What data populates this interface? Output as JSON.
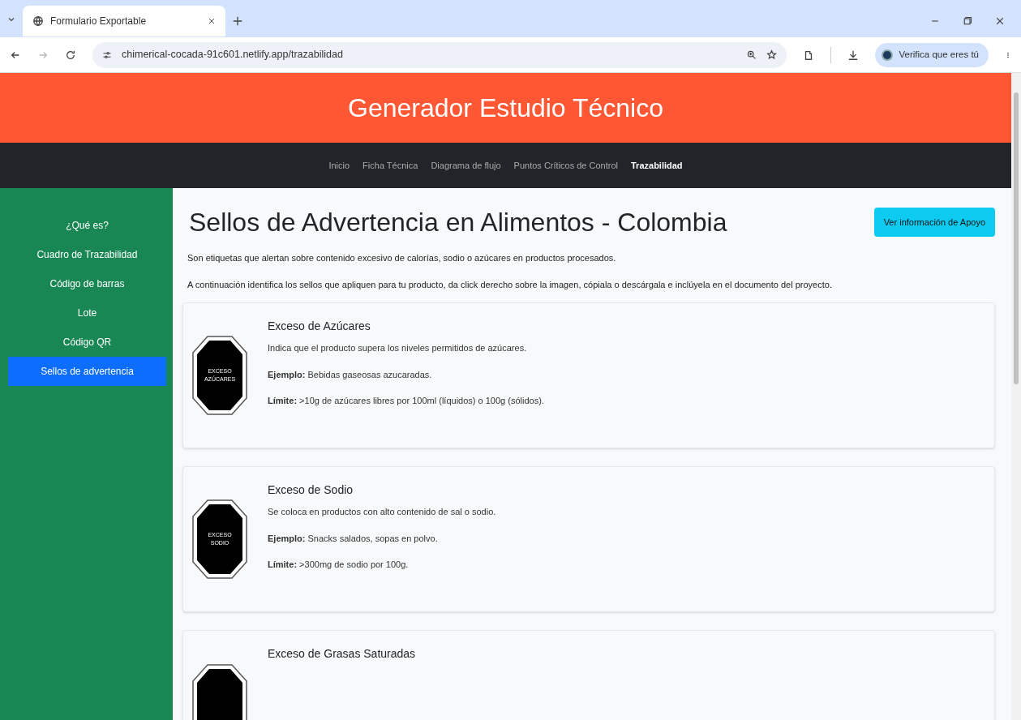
{
  "browser": {
    "tab_title": "Formulario Exportable",
    "url": "chimerical-cocada-91c601.netlify.app/trazabilidad",
    "profile_label": "Verifica que eres tú"
  },
  "header": {
    "title": "Generador Estudio Técnico"
  },
  "nav": [
    {
      "label": "Inicio",
      "selected": false
    },
    {
      "label": "Ficha Técnica",
      "selected": false
    },
    {
      "label": "Diagrama de flujo",
      "selected": false
    },
    {
      "label": "Puntos Críticos de Control",
      "selected": false
    },
    {
      "label": "Trazabilidad",
      "selected": true
    }
  ],
  "sidebar": {
    "items": [
      {
        "label": "¿Qué es?",
        "selected": false
      },
      {
        "label": "Cuadro de Trazabilidad",
        "selected": false
      },
      {
        "label": "Código de barras",
        "selected": false
      },
      {
        "label": "Lote",
        "selected": false
      },
      {
        "label": "Código QR",
        "selected": false
      },
      {
        "label": "Sellos de advertencia",
        "selected": true
      }
    ]
  },
  "content": {
    "title": "Sellos de Advertencia en Alimentos - Colombia",
    "support_button": "Ver información de Apoyo",
    "paragraphs": [
      "Son etiquetas que alertan sobre contenido excesivo de calorías, sodio o azúcares en productos procesados.",
      "A continuación identifica los sellos que apliquen para tu producto, da click derecho sobre la imagen, cópiala o descárgala e inclúyela en el documento del proyecto."
    ],
    "cards": [
      {
        "title": "Exceso de Azúcares",
        "seal_lines": [
          "EXCESO",
          "AZÚCARES"
        ],
        "description": "Indica que el producto supera los niveles permitidos de azúcares.",
        "example": "**Ejemplo:** Bebidas gaseosas azucaradas.",
        "limit": "**Límite:** >10g de azúcares libres por 100ml (líquidos) o 100g (sólidos)."
      },
      {
        "title": "Exceso de Sodio",
        "seal_lines": [
          "EXCESO",
          "SODIO"
        ],
        "description": "Se coloca en productos con alto contenido de sal o sodio.",
        "example": "**Ejemplo:** Snacks salados, sopas en polvo.",
        "limit": "**Límite:** >300mg de sodio por 100g."
      },
      {
        "title": "Exceso de Grasas Saturadas"
      }
    ]
  }
}
